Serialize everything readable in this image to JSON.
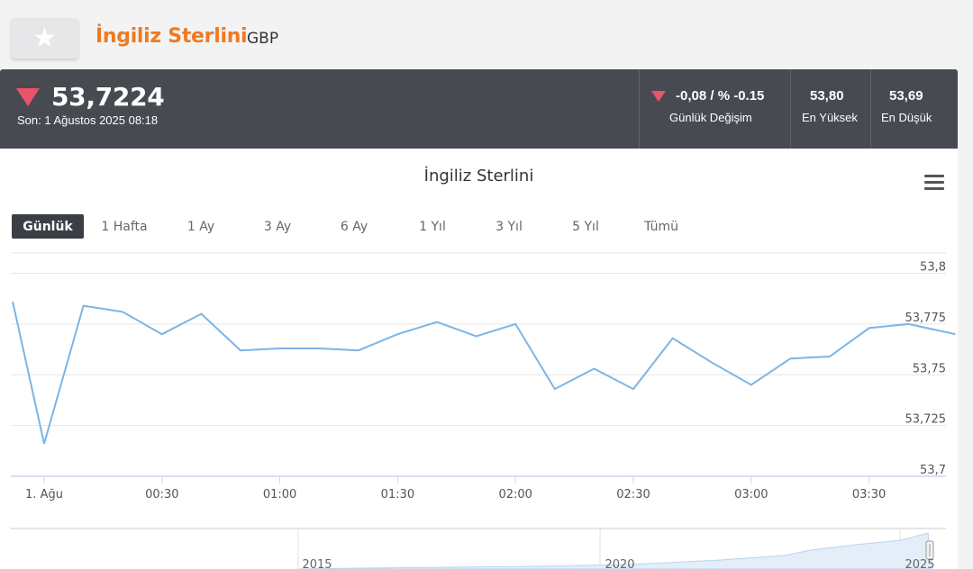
{
  "header": {
    "title": "İngiliz Sterlini",
    "code": "GBP",
    "favorite_icon": "star-icon"
  },
  "quote": {
    "price": "53,7224",
    "last_update": "Son: 1 Ağustos 2025 08:18",
    "direction": "down",
    "daily_change": "-0,08 / % -0.15",
    "daily_change_label": "Günlük Değişim",
    "high": "53,80",
    "high_label": "En Yüksek",
    "low": "53,69",
    "low_label": "En Düşük",
    "down_color": "#e9546b"
  },
  "chart": {
    "title": "İngiliz Sterlini",
    "ranges": [
      "Günlük",
      "1 Hafta",
      "1 Ay",
      "3 Ay",
      "6 Ay",
      "1 Yıl",
      "3 Yıl",
      "5 Yıl",
      "Tümü"
    ],
    "active_range": "Günlük",
    "line_color": "#7cb5e6"
  },
  "navigator": {
    "labels": [
      "2015",
      "2020",
      "2025"
    ]
  },
  "chart_data": {
    "type": "line",
    "title": "İngiliz Sterlini",
    "x_tick_labels": [
      "1. Ağu",
      "00:30",
      "01:00",
      "01:30",
      "02:00",
      "02:30",
      "03:00",
      "03:30"
    ],
    "y_tick_labels": [
      "53,7",
      "53,725",
      "53,75",
      "53,775",
      "53,8"
    ],
    "ylim": [
      53.7,
      53.81
    ],
    "x_unit": "minutes from 1. Ağu 00:00",
    "series": [
      {
        "x": [
          -8,
          0,
          10,
          20,
          30,
          40,
          50,
          60,
          70,
          80,
          90,
          100,
          110,
          120,
          130,
          140,
          150,
          160,
          170,
          180,
          190,
          200,
          210,
          220,
          232
        ],
        "y": [
          53.786,
          53.716,
          53.784,
          53.781,
          53.77,
          53.78,
          53.762,
          53.763,
          53.763,
          53.762,
          53.77,
          53.776,
          53.769,
          53.775,
          53.743,
          53.753,
          53.743,
          53.768,
          53.756,
          53.745,
          53.758,
          53.759,
          53.773,
          53.775,
          53.77
        ]
      }
    ],
    "grid": true
  }
}
